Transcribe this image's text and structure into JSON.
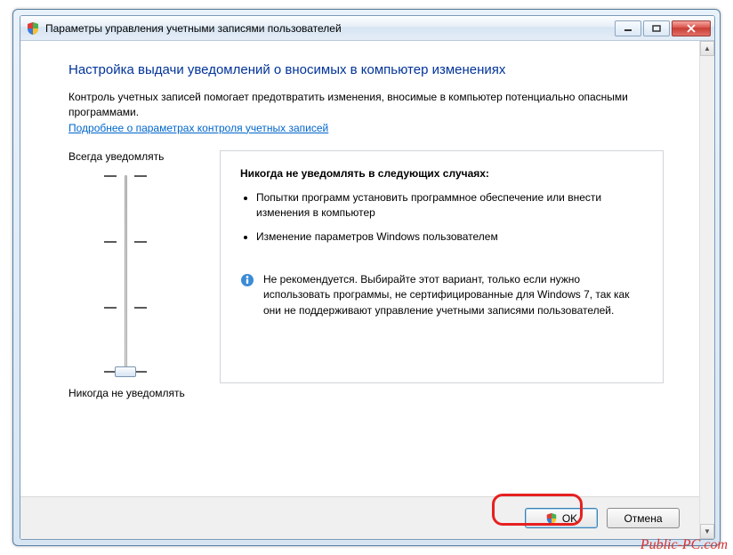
{
  "window": {
    "title": "Параметры управления учетными записями пользователей"
  },
  "page": {
    "heading": "Настройка выдачи уведомлений о вносимых в компьютер изменениях",
    "intro": "Контроль учетных записей помогает предотвратить изменения, вносимые в компьютер потенциально опасными программами.",
    "learn_more_link": "Подробнее о параметрах контроля учетных записей"
  },
  "slider": {
    "top_label": "Всегда уведомлять",
    "bottom_label": "Никогда не уведомлять",
    "levels": 4,
    "current_level": 0
  },
  "info_panel": {
    "title": "Никогда не уведомлять в следующих случаях:",
    "bullets": [
      "Попытки программ установить программное обеспечение или внести изменения в компьютер",
      "Изменение параметров Windows пользователем"
    ],
    "recommendation": "Не рекомендуется. Выбирайте этот вариант, только если нужно использовать программы, не сертифицированные для Windows 7, так как они не поддерживают управление учетными записями пользователей."
  },
  "buttons": {
    "ok": "OK",
    "cancel": "Отмена"
  },
  "watermark": "Public-PC.com"
}
